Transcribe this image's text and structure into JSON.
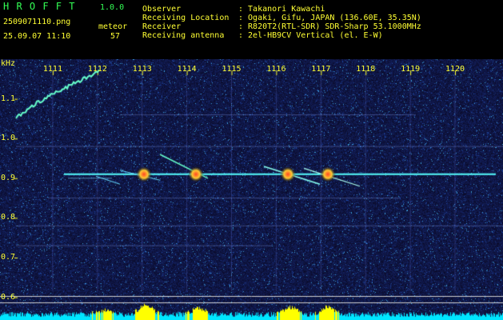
{
  "header": {
    "app_name": "H R O F F T",
    "version": "1.0.0",
    "file_name": "2509071110.png",
    "datetime": "25.09.07 11:10",
    "meteor_label": "meteor",
    "meteor_count": "57",
    "info": [
      {
        "key": "Observer",
        "value": ": Takanori Kawachi"
      },
      {
        "key": "Receiving Location",
        "value": ": Ogaki, Gifu, JAPAN (136.60E, 35.35N)"
      },
      {
        "key": "Receiver",
        "value": ": R820T2(RTL-SDR) SDR-Sharp 53.1000MHz"
      },
      {
        "key": "Receiving antenna",
        "value": ": 2el-HB9CV Vertical (el. E-W)"
      }
    ]
  },
  "axes": {
    "y_unit": "kHz",
    "x_ticks": [
      "1111",
      "1112",
      "1113",
      "1114",
      "1115",
      "1116",
      "1117",
      "1118",
      "1119",
      "1120"
    ],
    "y_ticks": [
      "1.1",
      "1.0",
      "0.9",
      "0.8",
      "0.7",
      "0.6"
    ]
  },
  "colors": {
    "background": "#0a0a4a",
    "text": "#ffff33",
    "title": "#33ff55",
    "signal": "#55ffff",
    "strong": "#ff5533",
    "meter_high": "#ffff00",
    "meter_low": "#00e5ff"
  }
}
